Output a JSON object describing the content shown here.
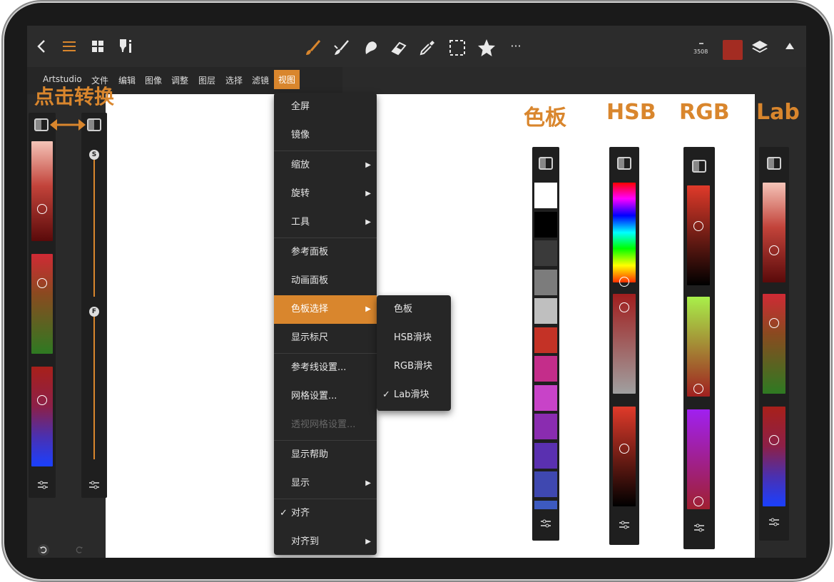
{
  "toolbar": {
    "back_icon": "chevron-left-icon",
    "menu_icon": "hamburger-icon",
    "grid_icon": "grid-icon",
    "brush_settings_icon": "brush-settings-icon",
    "tools": [
      "brush",
      "smudge",
      "blend",
      "eraser",
      "eyedropper",
      "selection",
      "favorite",
      "more"
    ],
    "more_label": "···",
    "brush_size": "3508",
    "current_color": "#a32c22",
    "accent": "#d9862d"
  },
  "menubar": {
    "items": [
      "Artstudio",
      "文件",
      "编辑",
      "图像",
      "调整",
      "图层",
      "选择",
      "滤镜",
      "视图"
    ],
    "active": "视图"
  },
  "annotation": {
    "tap_to_switch": "点击转换"
  },
  "view_menu": {
    "items": [
      {
        "label": "全屏"
      },
      {
        "label": "镜像"
      },
      {
        "label": "缩放",
        "arrow": "▶"
      },
      {
        "label": "旋转",
        "arrow": "▶"
      },
      {
        "label": "工具",
        "arrow": "▶"
      },
      {
        "label": "参考面板"
      },
      {
        "label": "动画面板"
      },
      {
        "label": "色板选择",
        "arrow": "▶"
      },
      {
        "label": "显示标尺"
      },
      {
        "label": "参考线设置..."
      },
      {
        "label": "网格设置..."
      },
      {
        "label": "透视网格设置..."
      },
      {
        "label": "显示帮助"
      },
      {
        "label": "显示",
        "arrow": "▶"
      },
      {
        "label": "对齐",
        "check": "✓"
      },
      {
        "label": "对齐到",
        "arrow": "▶"
      }
    ]
  },
  "palette_submenu": {
    "items": [
      {
        "label": "色板"
      },
      {
        "label": "HSB滑块"
      },
      {
        "label": "RGB滑块"
      },
      {
        "label": "Lab滑块",
        "check": "✓"
      }
    ]
  },
  "panel_headings": {
    "swatches": "色板",
    "hsb": "HSB",
    "rgb": "RGB",
    "lab": "Lab"
  },
  "brush_panel": {
    "size_label": "S",
    "flow_label": "F"
  },
  "swatch_colors": [
    "#ffffff",
    "#000000",
    "#3a3a3a",
    "#7c7c7c",
    "#bfbfbf",
    "#c43226",
    "#c42d8a",
    "#c843c8",
    "#8a2cb0",
    "#5a30b0",
    "#3f48b0",
    "#3d5ac0"
  ],
  "bottom": {
    "undo_icon": "undo-icon",
    "redo_icon": "redo-icon"
  }
}
